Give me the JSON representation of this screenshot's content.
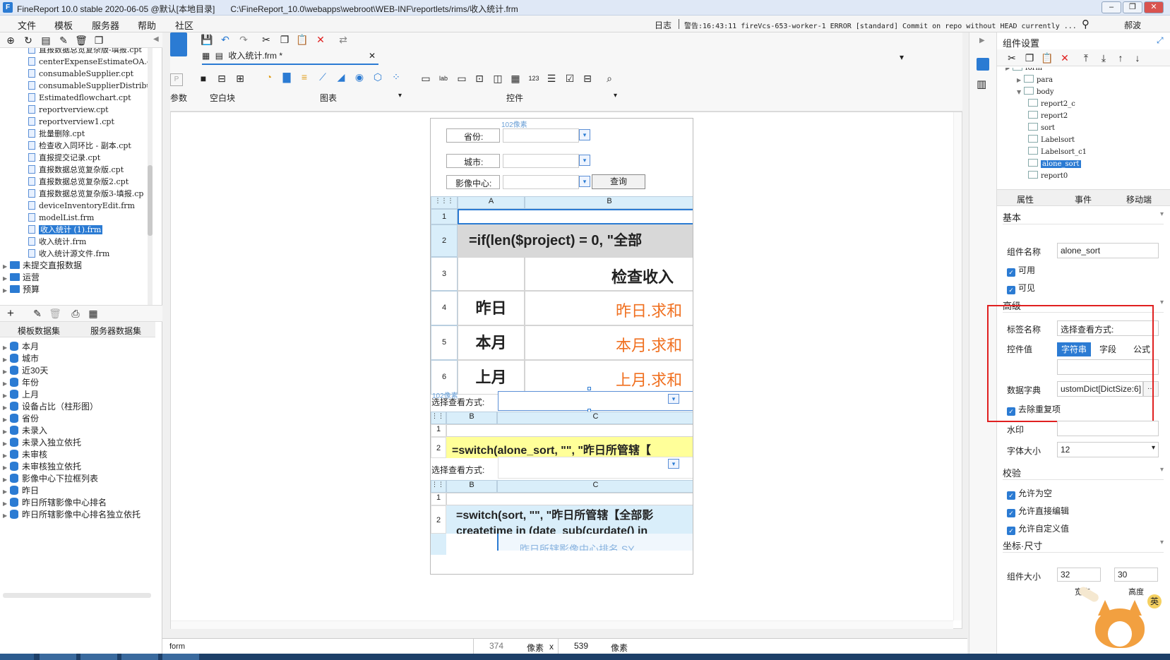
{
  "titlebar": {
    "title": "FineReport 10.0 stable 2020-06-05 @默认[本地目录]",
    "path": "C:\\FineReport_10.0\\webapps\\webroot\\WEB-INF\\reportlets/rims/收入统计.frm",
    "minimize": "‒",
    "restore": "❐",
    "close": "✕"
  },
  "menubar": {
    "items": [
      "文件",
      "模板",
      "服务器",
      "帮助",
      "社区"
    ],
    "log_label": "日志",
    "alert": "警告:16:43:11 fireVcs-653-worker-1 ERROR [standard] Commit on repo without HEAD currently ...",
    "user": "郝波"
  },
  "file_tree": {
    "files": [
      "直报数据总览复杂版-填报.cpt",
      "centerExpenseEstimateOA.cpt",
      "consumableSupplier.cpt",
      "consumableSupplierDistribut",
      "Estimatedflowchart.cpt",
      "reportverview.cpt",
      "reportverview1.cpt",
      "批量删除.cpt",
      "检查收入同环比 - 副本.cpt",
      "直报提交记录.cpt",
      "直报数据总览复杂版.cpt",
      "直报数据总览复杂版2.cpt",
      "直报数据总览复杂版3-填报.cp",
      "deviceInventoryEdit.frm",
      "modelList.frm",
      "收入统计 (1).frm",
      "收入统计.frm",
      "收入统计源文件.frm"
    ],
    "folders": [
      "未提交直报数据",
      "运营",
      "预算"
    ]
  },
  "dataset_tabs": [
    "模板数据集",
    "服务器数据集"
  ],
  "datasets": [
    "本月",
    "城市",
    "近30天",
    "年份",
    "上月",
    "设备占比（柱形图）",
    "省份",
    "未录入",
    "未录入独立依托",
    "未审核",
    "未审核独立依托",
    "影像中心下拉框列表",
    "昨日",
    "昨日所辖影像中心排名",
    "昨日所辖影像中心排名独立依托"
  ],
  "editor_tab": "收入统计.frm *",
  "widget_groups": {
    "param": "参数",
    "blank": "空白块",
    "chart": "图表",
    "control": "控件"
  },
  "form": {
    "pixel_hint": "102像素",
    "province_label": "省份:",
    "city_label": "城市:",
    "center_label": "影像中心:",
    "query_button": "查询",
    "col_a": "A",
    "col_b": "B",
    "col_c": "C",
    "row_nums": [
      "1",
      "2",
      "3",
      "4",
      "5",
      "6"
    ],
    "formula1": "=if(len($project) = 0, \"全部",
    "title_cell": "检查收入",
    "rows": [
      {
        "label": "昨日",
        "value": "昨日.求和"
      },
      {
        "label": "本月",
        "value": "本月.求和"
      },
      {
        "label": "上月",
        "value": "上月.求和"
      }
    ],
    "sort_label_1": "选择查看方式:",
    "formula2": "=switch(alone_sort, \"\", \"昨日所管辖【",
    "sort_label_2": "选择查看方式:",
    "formula3": "=switch(sort, \"\", \"昨日所管辖【全部影",
    "formula3_line2": "createtime in (date_sub(curdate() in",
    "cut_text": "昨日所辖影像中心排名.SY"
  },
  "status": {
    "left": "form",
    "width": "374",
    "unit1": "像素",
    "x": "x",
    "height": "539",
    "unit2": "像素"
  },
  "right_panel": {
    "title": "组件设置",
    "tree": [
      {
        "name": "form",
        "level": 0
      },
      {
        "name": "para",
        "level": 1
      },
      {
        "name": "body",
        "level": 1
      },
      {
        "name": "report2_c",
        "level": 2
      },
      {
        "name": "report2",
        "level": 2
      },
      {
        "name": "sort",
        "level": 2
      },
      {
        "name": "Labelsort",
        "level": 2
      },
      {
        "name": "Labelsort_c1",
        "level": 2
      },
      {
        "name": "alone_sort",
        "level": 2
      },
      {
        "name": "report0",
        "level": 2
      }
    ],
    "tabs": [
      "属性",
      "事件",
      "移动端"
    ],
    "basic": "基本",
    "name_label": "组件名称",
    "name_value": "alone_sort",
    "enabled": "可用",
    "visible": "可见",
    "advanced": "高级",
    "tag_label": "标签名称",
    "tag_value": "选择查看方式:",
    "value_label": "控件值",
    "value_modes": [
      "字符串",
      "字段",
      "公式"
    ],
    "dict_label": "数据字典",
    "dict_value": "ustomDict[DictSize:6]",
    "dict_btn": "···",
    "dedupe": "去除重复项",
    "watermark": "水印",
    "fontsize_label": "字体大小",
    "fontsize_value": "12",
    "validate": "校验",
    "allow_empty": "允许为空",
    "allow_edit": "允许直接编辑",
    "allow_custom": "允许自定义值",
    "coords": "坐标·尺寸",
    "size_label": "组件大小",
    "size_w": "32",
    "size_h": "30",
    "w_unit": "宽度",
    "h_unit": "高度",
    "ime_badge": "英"
  },
  "colors": {
    "accent": "#2b7bd3",
    "orange": "#f07020",
    "highlight_red": "#e02020",
    "yellow_cell": "#ffff99"
  }
}
